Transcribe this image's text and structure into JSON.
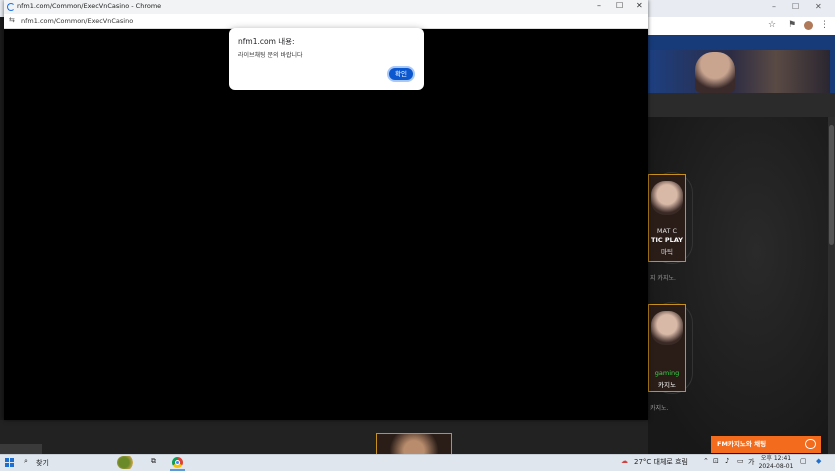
{
  "popup": {
    "window_title": "nfm1.com/Common/ExecVnCasino - Chrome",
    "address": "nfm1.com/Common/ExecVnCasino"
  },
  "dialog": {
    "title": "nfm1.com 내용:",
    "message": "라이브채팅 문의 바랍니다",
    "ok_label": "확인"
  },
  "background_page": {
    "card1": {
      "line1": "MAT C",
      "line2": "TIC PLAY",
      "line3": "마틱"
    },
    "card1_caption": "지 카지노.",
    "card2": {
      "line1": "gaming",
      "line2": "카지노"
    },
    "card2_caption": "카지노.",
    "chat_button_label": "FM카지노와 채팅"
  },
  "taskbar": {
    "search_label": "찾기",
    "weather": "27°C 대체로 흐림",
    "ime": "가",
    "time": "오후 12:41",
    "date": "2024-08-01"
  },
  "colors": {
    "accent": "#0b57d0",
    "chat_orange": "#f36b1c",
    "card_border": "#c8901c"
  }
}
